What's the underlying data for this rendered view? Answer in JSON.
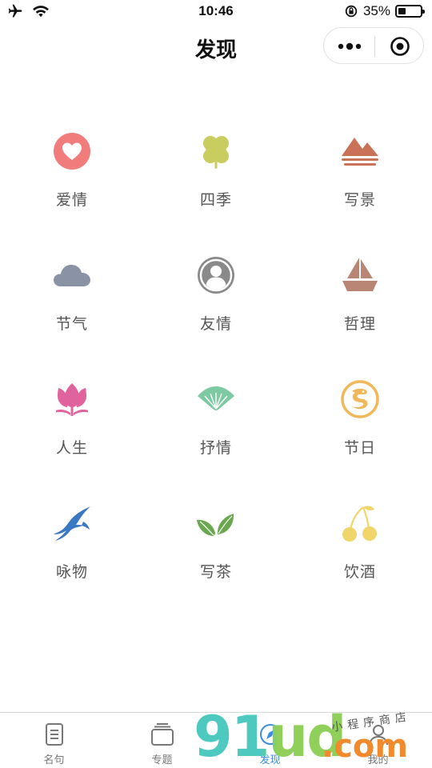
{
  "status_bar": {
    "time": "10:46",
    "battery_text": "35%",
    "battery_level": 0.35,
    "icons": [
      "airplane-icon",
      "wifi-icon",
      "orientation-lock-icon",
      "battery-icon"
    ]
  },
  "nav": {
    "title": "发现",
    "menu_icon": "more-dots-icon",
    "close_icon": "target-circle-icon"
  },
  "categories": [
    {
      "label": "爱情",
      "icon": "heart-icon",
      "color": "#f07c7c"
    },
    {
      "label": "四季",
      "icon": "clover-icon",
      "color": "#c9cc5e"
    },
    {
      "label": "写景",
      "icon": "mountain-icon",
      "color": "#c97258"
    },
    {
      "label": "节气",
      "icon": "cloud-icon",
      "color": "#8a93a5"
    },
    {
      "label": "友情",
      "icon": "person-icon",
      "color": "#8a8a8a"
    },
    {
      "label": "哲理",
      "icon": "sailboat-icon",
      "color": "#b98675"
    },
    {
      "label": "人生",
      "icon": "lotus-icon",
      "color": "#e0639e"
    },
    {
      "label": "抒情",
      "icon": "fan-icon",
      "color": "#7cc9a2"
    },
    {
      "label": "节日",
      "icon": "dragon-icon",
      "color": "#f0b85b"
    },
    {
      "label": "咏物",
      "icon": "swallow-icon",
      "color": "#3b78c2"
    },
    {
      "label": "写茶",
      "icon": "tea-leaf-icon",
      "color": "#6aa84f"
    },
    {
      "label": "饮酒",
      "icon": "cherry-icon",
      "color": "#f0d56a"
    }
  ],
  "tab_bar": {
    "tabs": [
      {
        "label": "名句",
        "icon": "document-icon",
        "active": false
      },
      {
        "label": "专题",
        "icon": "stack-icon",
        "active": false
      },
      {
        "label": "发现",
        "icon": "compass-icon",
        "active": true
      },
      {
        "label": "我的",
        "icon": "user-icon",
        "active": false
      }
    ],
    "active_color": "#3a8de0",
    "inactive_color": "#777777"
  },
  "watermark": {
    "brand": "91ud",
    "suffix": ".com",
    "subtitle": "小程序商店",
    "colors": [
      "#4ec9c0",
      "#8fcf5a",
      "#f08a2c"
    ]
  }
}
